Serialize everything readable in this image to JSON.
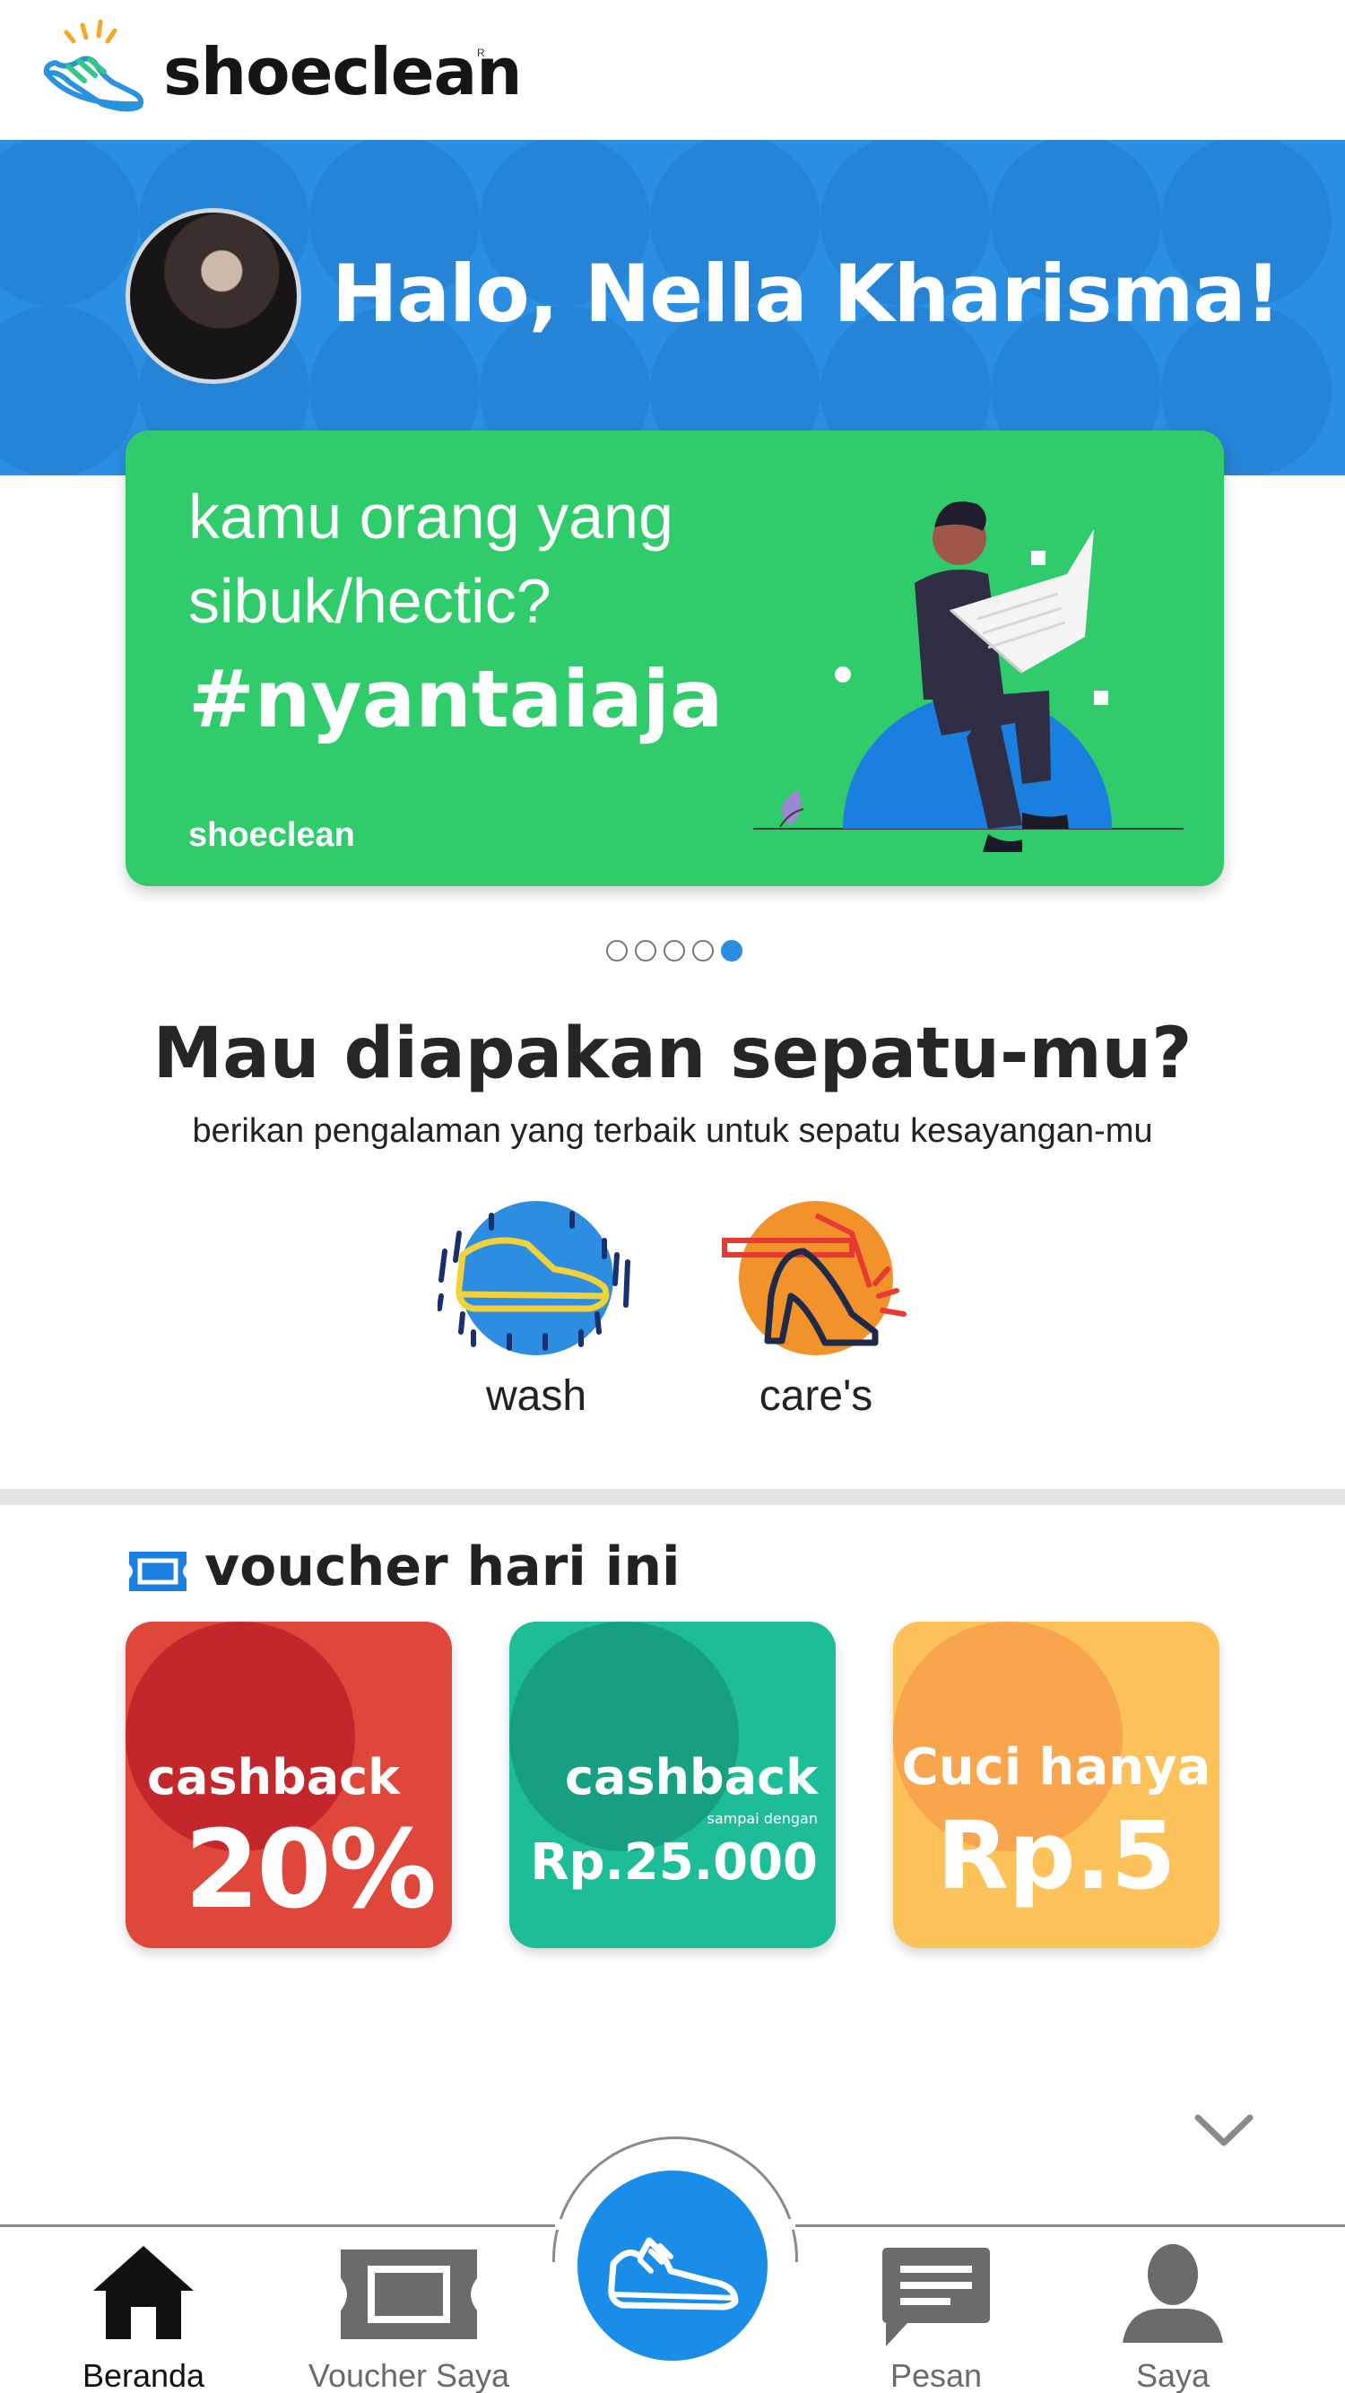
{
  "app": {
    "brand_name": "shoeclean",
    "brand_mark": "R"
  },
  "hero": {
    "greeting": "Halo, Nella Kharisma!",
    "bg_color": "#2a8ee3"
  },
  "promo": {
    "line1": "kamu orang yang",
    "line2": "sibuk/hectic?",
    "hashtag": "#nyantaiaja",
    "brand": "shoeclean",
    "bg_color": "#30cc6c"
  },
  "carousel": {
    "total": 5,
    "active_index": 4
  },
  "services_section": {
    "title": "Mau diapakan sepatu-mu?",
    "subtitle": "berikan pengalaman yang terbaik untuk sepatu kesayangan-mu",
    "items": [
      {
        "label": "wash",
        "icon": "sneaker-wash-icon"
      },
      {
        "label": "care's",
        "icon": "heel-care-icon"
      }
    ]
  },
  "vouchers": {
    "title": "voucher hari ini",
    "items": [
      {
        "line1": "cashback",
        "line2": "20%",
        "color": "#e0473b",
        "blob": "#c4272b"
      },
      {
        "line1": "cashback",
        "small": "sampai dengan",
        "line2": "Rp.25.000",
        "color": "#1dbd98",
        "blob": "#16a081"
      },
      {
        "line1": "Cuci hanya",
        "line2": "Rp.5",
        "color": "#fec25b",
        "blob": "#f8a54d"
      }
    ]
  },
  "nav": {
    "home": "Beranda",
    "vouchers": "Voucher Saya",
    "messages": "Pesan",
    "profile": "Saya",
    "fab_color": "#1a8de8"
  }
}
